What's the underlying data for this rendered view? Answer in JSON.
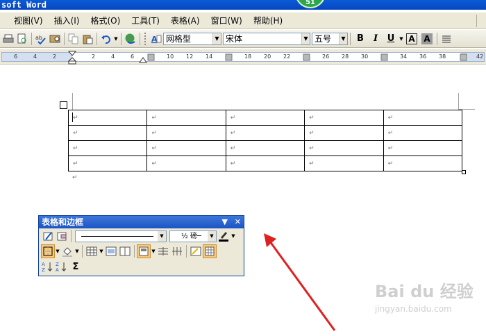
{
  "window": {
    "title": "soft Word",
    "badge": "51"
  },
  "menu": {
    "items": [
      "视图(V)",
      "插入(I)",
      "格式(O)",
      "工具(T)",
      "表格(A)",
      "窗口(W)",
      "帮助(H)"
    ]
  },
  "toolbar": {
    "style_value": "网格型",
    "font_value": "宋体",
    "size_value": "五号",
    "bold_label": "B",
    "italic_label": "I",
    "underline_label": "U",
    "char_border_label": "A",
    "char_shading_label": "A"
  },
  "ruler": {
    "ticks": [
      "6",
      "4",
      "2",
      "2",
      "4",
      "6",
      "10",
      "12",
      "14",
      "18",
      "20",
      "22",
      "26",
      "28",
      "30",
      "34",
      "36",
      "38",
      "42"
    ]
  },
  "document": {
    "table": {
      "rows": 4,
      "cols": 5,
      "cell_mark": "↵"
    },
    "paragraph_mark": "↵",
    "move_handle_glyph": "✛"
  },
  "float_toolbar": {
    "title": "表格和边框",
    "weight_value": "½ 磅─",
    "sum_label": "Σ"
  },
  "watermark": {
    "text": "Bai du 经验",
    "url": "jingyan.baidu.com"
  },
  "colors": {
    "arrow": "#e02020",
    "titlebar": "#0a5bd6"
  }
}
